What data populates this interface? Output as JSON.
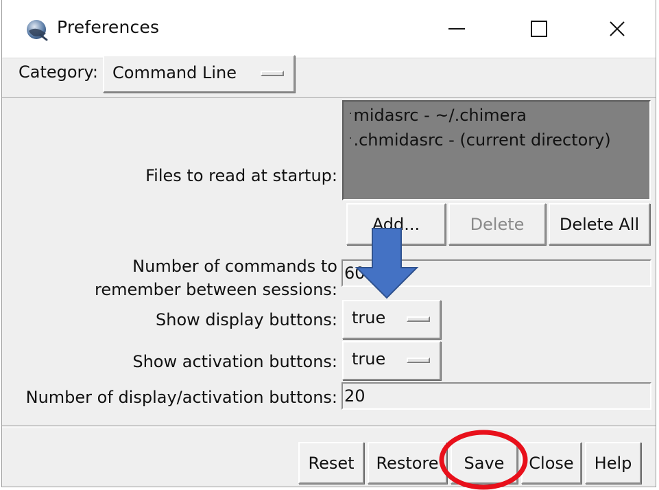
{
  "window": {
    "title": "Preferences",
    "app_icon": "chimera-logo-icon",
    "controls": {
      "minimize": "minimize-icon",
      "maximize": "maximize-icon",
      "close": "close-icon"
    }
  },
  "category": {
    "label": "Category:",
    "selected": "Command Line"
  },
  "startup_files": {
    "label": "Files to read at startup:",
    "items": [
      "midasrc - ~/.chimera",
      ".chmidasrc - (current directory)"
    ],
    "bullet": "·",
    "buttons": {
      "add": "Add...",
      "delete": "Delete",
      "delete_all": "Delete All"
    }
  },
  "commands_remember": {
    "label_line1": "Number of commands to",
    "label_line2": "remember between sessions:",
    "value": "60"
  },
  "display_buttons": {
    "label": "Show display buttons:",
    "value": "true"
  },
  "activation_buttons": {
    "label": "Show activation buttons:",
    "value": "true"
  },
  "num_buttons": {
    "label": "Number of display/activation buttons:",
    "value": "20"
  },
  "footer": {
    "reset": "Reset",
    "restore": "Restore",
    "save": "Save",
    "close": "Close",
    "help": "Help"
  },
  "annotations": {
    "arrow_color": "#4472c4",
    "arrow_outline": "#2f528f",
    "circle_color": "#e8101b"
  }
}
